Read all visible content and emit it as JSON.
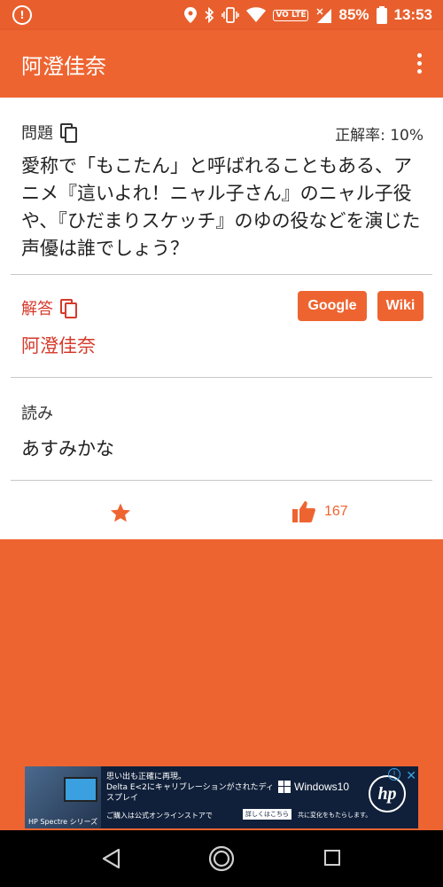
{
  "status_bar": {
    "battery": "85%",
    "time": "13:53",
    "volte": "VO LTE"
  },
  "app_bar": {
    "title": "阿澄佳奈"
  },
  "question_section": {
    "label": "問題",
    "accuracy": "正解率: 10%",
    "text": "愛称で「もこたん」と呼ばれることもある、アニメ『這いよれ！ニャル子さん』のニャル子役や、『ひだまりスケッチ』のゆの役などを演じた声優は誰でしょう？"
  },
  "answer_section": {
    "label": "解答",
    "answer": "阿澄佳奈",
    "google_button": "Google",
    "wiki_button": "Wiki"
  },
  "reading_section": {
    "label": "読み",
    "reading": "あすみかな"
  },
  "actions": {
    "like_count": "167"
  },
  "ad": {
    "line1": "思い出も正確に再現。",
    "line2": "Delta E<2にキャリブレーションがされたディスプレイ",
    "line3": "ご購入は公式オンラインストアで",
    "button": "詳しくはこちら",
    "windows": "Windows10",
    "note": "共に変化をもたらします。",
    "caption": "HP Spectre シリーズ",
    "brand": "hp"
  },
  "colors": {
    "accent": "#ee6431",
    "answer_red": "#d63a2b"
  }
}
